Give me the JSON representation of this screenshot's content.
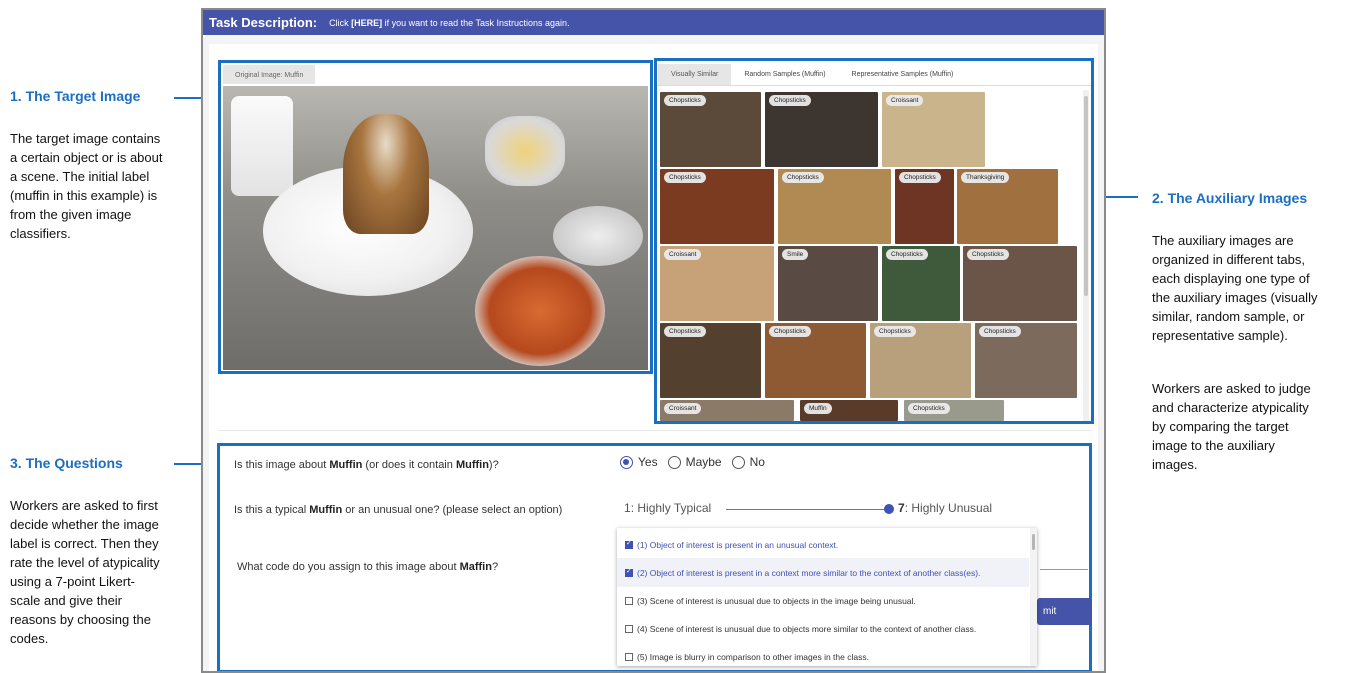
{
  "annotations": {
    "target": {
      "title": "1. The Target Image",
      "text_lines": [
        "The target image contains",
        "a certain object or is about",
        "a scene. The initial label",
        "(muffin in this example) is",
        "from the given image",
        "classifiers."
      ]
    },
    "auxiliary": {
      "title": "2. The Auxiliary Images",
      "text_lines": [
        "The auxiliary images are",
        "organized in different tabs,",
        "each displaying one type of",
        "the auxiliary images (visually",
        "similar, random sample, or",
        "representative sample)."
      ],
      "text2_lines": [
        "Workers are asked to judge",
        "and characterize atypicality",
        "by comparing the target",
        "image to the auxiliary",
        "images."
      ]
    },
    "questions": {
      "title": "3. The Questions",
      "text_lines": [
        "Workers are asked to first",
        "decide whether the image",
        "label is correct. Then they",
        "rate the level of atypicality",
        "using a 7-point Likert-",
        "scale and give their",
        "reasons by choosing the",
        "codes."
      ]
    }
  },
  "header": {
    "title": "Task Description:",
    "msg_pre": "Click ",
    "msg_link": "[HERE]",
    "msg_post": " if you want to read the Task Instructions again."
  },
  "target_panel": {
    "tab_label": "Original Image: Muffin"
  },
  "aux_panel": {
    "tabs": [
      "Visually Similar",
      "Random Samples (Muffin)",
      "Representative Samples (Muffin)"
    ],
    "active_tab": 0,
    "thumbnails": [
      "Chopsticks",
      "Chopsticks",
      "Croissant",
      "Chopsticks",
      "Chopsticks",
      "Chopsticks",
      "Thanksgiving",
      "Croissant",
      "Smile",
      "Chopsticks",
      "Chopsticks",
      "Chopsticks",
      "Chopsticks",
      "Chopsticks",
      "Chopsticks",
      "Croissant",
      "Muffin",
      "Chopsticks"
    ]
  },
  "questions": {
    "q1": {
      "pre": "Is this image about ",
      "bold": "Muffin",
      "mid": " (or does it contain ",
      "bold2": "Muffin",
      "post": ")?"
    },
    "q1_options": [
      "Yes",
      "Maybe",
      "No"
    ],
    "q1_selected": "Yes",
    "q2": {
      "pre": "Is this a typical ",
      "bold": "Muffin",
      "post": " or an unusual one? (please select an option)"
    },
    "likert": {
      "left_num": "1",
      "left_label": ": Highly Typical",
      "right_num": "7",
      "right_label": ": Highly Unusual",
      "value": 7
    },
    "q3": {
      "pre": "What code do you assign to this image about ",
      "bold": "Maffin",
      "post": "?"
    },
    "codes": [
      {
        "label": "(1) Object of interest is present in an unusual context.",
        "checked": true
      },
      {
        "label": "(2) Object of interest is present in a context more similar to the context of another class(es).",
        "checked": true
      },
      {
        "label": "(3) Scene of interest is unusual due to objects in the image being unusual.",
        "checked": false
      },
      {
        "label": "(4) Scene of interest is unusual due to objects more similar to the context of another class.",
        "checked": false
      },
      {
        "label": "(5) Image is blurry in comparison to other images in the class.",
        "checked": false
      }
    ],
    "submit_label": "mit"
  },
  "colors": {
    "accent": "#1b6fc2",
    "header": "#4553a8",
    "primary": "#3f51b5"
  }
}
